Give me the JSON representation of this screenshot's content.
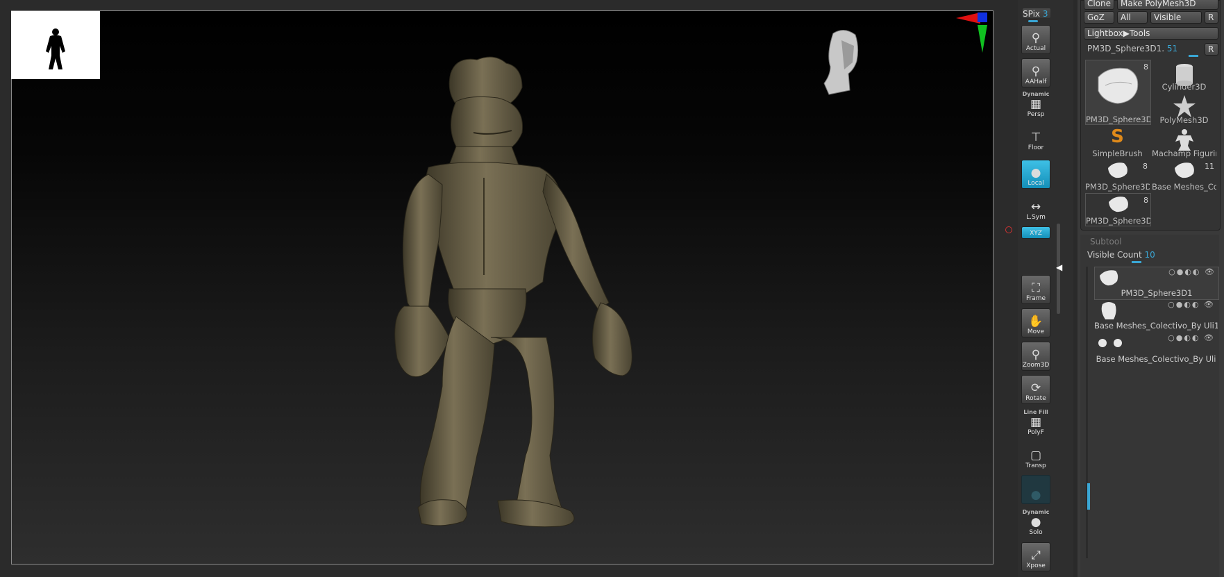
{
  "shelf": {
    "spix_label": "SPix",
    "spix_value": "3",
    "buttons": [
      {
        "label": "Actual"
      },
      {
        "label": "AAHalf"
      },
      {
        "top": "Dynamic",
        "label": "Persp"
      },
      {
        "label": "Floor"
      },
      {
        "label": "Local"
      },
      {
        "label": "L.Sym"
      },
      {
        "label": "XYZ"
      },
      {
        "label": "Frame"
      },
      {
        "label": "Move"
      },
      {
        "label": "Zoom3D"
      },
      {
        "label": "Rotate"
      },
      {
        "top": "Line Fill",
        "label": "PolyF"
      },
      {
        "label": "Transp"
      },
      {
        "label": ""
      },
      {
        "top": "Dynamic",
        "label": "Solo"
      },
      {
        "label": "Xpose"
      }
    ]
  },
  "tool_panel": {
    "clone": "Clone",
    "make_polymesh": "Make PolyMesh3D",
    "goz": "GoZ",
    "all": "All",
    "visible": "Visible",
    "r": "R",
    "lightbox": "Lightbox▶Tools",
    "current_tool": "PM3D_Sphere3D1.",
    "current_tool_count": "51",
    "r2": "R",
    "tools": [
      {
        "name": "PM3D_Sphere3D",
        "count": "8"
      },
      {
        "name": "Cylinder3D",
        "count": ""
      },
      {
        "name": "PolyMesh3D",
        "count": ""
      },
      {
        "name": "SimpleBrush",
        "count": ""
      },
      {
        "name": "Machamp Figurin",
        "count": ""
      },
      {
        "name": "PM3D_Sphere3D",
        "count": "8"
      },
      {
        "name": "Base Meshes_Co",
        "count": "11"
      },
      {
        "name": "PM3D_Sphere3D",
        "count": "8"
      }
    ]
  },
  "subtool": {
    "title": "Subtool",
    "visible_count_label": "Visible Count",
    "visible_count_value": "10",
    "items": [
      {
        "name": "PM3D_Sphere3D1"
      },
      {
        "name": "Base Meshes_Colectivo_By Uli1"
      },
      {
        "name": "Base Meshes_Colectivo_By Uli"
      }
    ]
  },
  "colors": {
    "accent": "#3aa6d4",
    "model": "#6b6248",
    "axis_x": "#e01010",
    "axis_y": "#10c020",
    "axis_z": "#1030e0"
  },
  "icons": [
    "figure-silhouette-icon",
    "head-orientation-icon",
    "axis-gizmo-icon"
  ]
}
